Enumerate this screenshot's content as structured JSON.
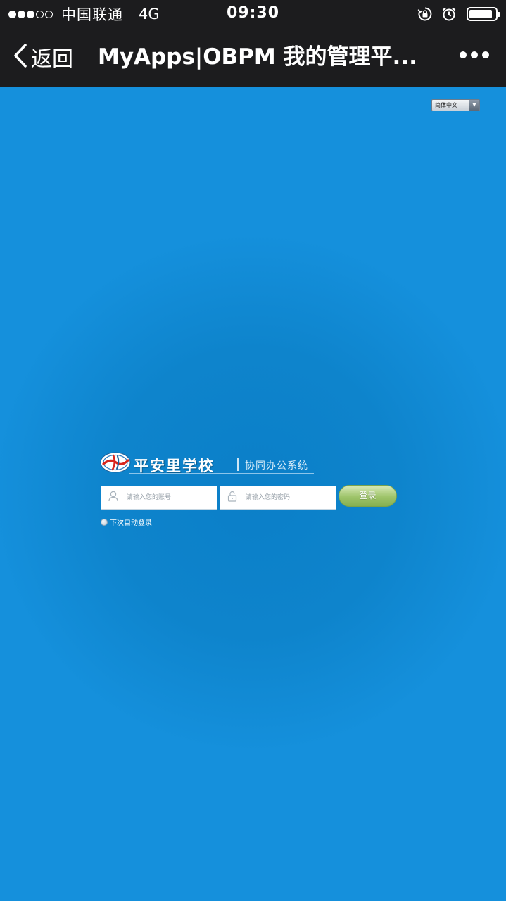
{
  "status_bar": {
    "signal_dots_filled": 3,
    "signal_dots_total": 5,
    "carrier": "中国联通",
    "network": "4G",
    "time": "09:30",
    "battery_level": 0.9,
    "icons": [
      "rotation-lock-icon",
      "alarm-icon",
      "battery-icon"
    ]
  },
  "nav": {
    "back_label": "返回",
    "title": "MyApps|OBPM 我的管理平...",
    "icons": [
      "chevron-left-icon",
      "more-icon"
    ]
  },
  "language": {
    "selected": "简体中文"
  },
  "logo": {
    "school_name": "平安里学校",
    "system_name": "协同办公系统"
  },
  "login": {
    "username_placeholder": "请输入您的账号",
    "password_placeholder": "请输入您的密码",
    "submit_label": "登录",
    "auto_login_label": "下次自动登录",
    "icons": [
      "user-icon",
      "lock-icon"
    ]
  },
  "colors": {
    "background": "#1590dc",
    "center_glow": "#0b7fc8",
    "bars": "#1c1c1e",
    "button_green": "#9ec46a"
  }
}
